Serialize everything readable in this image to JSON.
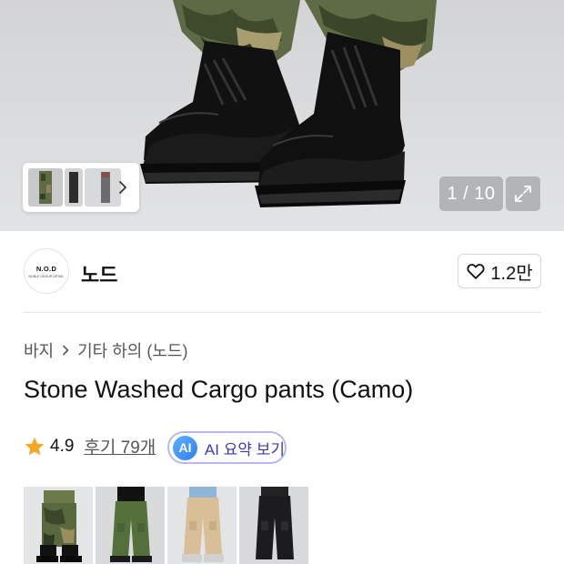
{
  "gallery": {
    "counter": "1 / 10",
    "thumbnail_strip": {
      "thumbs": [
        "camo-pants-thumb",
        "black-pants-thumb",
        "grey-pants-thumb"
      ]
    }
  },
  "brand": {
    "logo_title": "N.O.D",
    "logo_subtitle": "NOBLE ODOUR DETAIL",
    "name": "노드",
    "likes": "1.2만"
  },
  "breadcrumb": {
    "items": [
      "바지",
      "기타 하의 (노드)"
    ]
  },
  "product": {
    "title": "Stone Washed Cargo pants (Camo)"
  },
  "rating": {
    "score": "4.9",
    "reviews_label": "후기 79개"
  },
  "ai_summary": {
    "badge": "AI",
    "label": "AI 요약 보기"
  },
  "variants": [
    {
      "name": "Camo",
      "selected": true
    },
    {
      "name": "Khaki"
    },
    {
      "name": "Beige"
    },
    {
      "name": "Black"
    }
  ],
  "colors": {
    "accent_star": "#f5a623",
    "ai_border": "#b9b6f5",
    "ai_text": "#3c3ab5"
  }
}
